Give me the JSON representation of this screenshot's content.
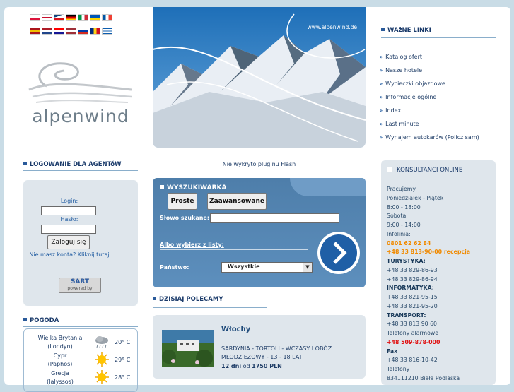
{
  "flags": [
    "pl",
    "gb",
    "cz",
    "de",
    "it",
    "ua",
    "fr",
    "es",
    "nl",
    "hr",
    "lv",
    "ru",
    "ro",
    "gr"
  ],
  "logo": {
    "text": "alpenwind"
  },
  "banner": {
    "url": "www.alpenwind.de"
  },
  "flash_msg": "Nie wykryto pluginu Flash",
  "links_section": {
    "title": "WAżNE LINKI",
    "items": [
      "Katalog ofert",
      "Nasze hotele",
      "Wycieczki objazdowe",
      "Informacje ogólne",
      "Index",
      "Last minute",
      "Wynajem autokarów (Policz sam)"
    ]
  },
  "login": {
    "title": "LOGOWANIE DLA AGENTóW",
    "login_label": "Login:",
    "password_label": "Hasło:",
    "submit_label": "Zaloguj się",
    "register_link": "Nie masz konta? Kliknij tutaj",
    "badge_top": "SART",
    "badge_bottom": "powered by"
  },
  "weather": {
    "title": "POGODA",
    "rows": [
      {
        "place": "Wielka Brytania",
        "city": "(Londyn)",
        "temp": "20° C",
        "icon": "cloudy-rain-icon"
      },
      {
        "place": "Cypr",
        "city": "(Paphos)",
        "temp": "29° C",
        "icon": "sun-icon"
      },
      {
        "place": "Grecja",
        "city": "(Ialyssos)",
        "temp": "28° C",
        "icon": "sun-icon"
      }
    ]
  },
  "search": {
    "title": "WYSZUKIWARKA",
    "tab_simple": "Proste",
    "tab_advanced": "Zaawansowane",
    "keyword_label": "Słowo szukane:",
    "lists_link": "Albo wybierz z listy:",
    "country_label": "Państwo:",
    "country_value": "Wszystkie"
  },
  "recommend": {
    "title": "DZISIAJ POLECAMY",
    "country": "Włochy",
    "desc": "SARDYNIA - TORTOLI - WCZASY I OBÓZ MŁODZIEZOWY - 13 - 18 LAT",
    "days": "12 dni",
    "from": "od",
    "price": "1750 PLN"
  },
  "consultants": {
    "title": "KONSULTANCI ONLINE",
    "lines": [
      {
        "t": "Pracujemy",
        "c": ""
      },
      {
        "t": "Poniedziałek - Piątek",
        "c": ""
      },
      {
        "t": "8:00 - 18:00",
        "c": ""
      },
      {
        "t": "Sobota",
        "c": ""
      },
      {
        "t": "9:00 - 14:00",
        "c": ""
      },
      {
        "t": "Infolinia:",
        "c": ""
      },
      {
        "t": "0801 62 62 84",
        "c": "orange"
      },
      {
        "t": "+48 33 813-90-00 recepcja",
        "c": "orange"
      },
      {
        "t": "TURYSTYKA:",
        "c": "bold"
      },
      {
        "t": "+48 33 829-86-93",
        "c": ""
      },
      {
        "t": "+48 33 829-86-94",
        "c": ""
      },
      {
        "t": "INFORMATYKA:",
        "c": "bold"
      },
      {
        "t": "+48 33 821-95-15",
        "c": ""
      },
      {
        "t": "+48 33 821-95-20",
        "c": ""
      },
      {
        "t": "TRANSPORT:",
        "c": "bold"
      },
      {
        "t": "+48 33 813 90 60",
        "c": ""
      },
      {
        "t": "Telefony alarmowe",
        "c": ""
      },
      {
        "t": "+48 509-878-000",
        "c": "red"
      },
      {
        "t": "Fax",
        "c": "bold"
      },
      {
        "t": "+48 33 816-10-42",
        "c": ""
      },
      {
        "t": "Telefony",
        "c": ""
      },
      {
        "t": "834111210 Biała Podlaska",
        "c": ""
      }
    ]
  }
}
